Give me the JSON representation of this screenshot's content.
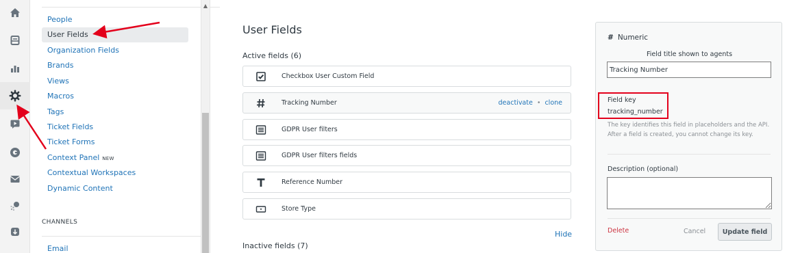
{
  "rail": {
    "items": [
      {
        "icon": "home-icon"
      },
      {
        "icon": "inbox-icon"
      },
      {
        "icon": "reporting-icon"
      },
      {
        "icon": "gear-icon",
        "active": true
      },
      {
        "icon": "play-icon"
      },
      {
        "icon": "guide-icon"
      },
      {
        "icon": "mail-icon"
      },
      {
        "icon": "explore-icon"
      },
      {
        "icon": "shield-icon"
      }
    ]
  },
  "nav": {
    "items": [
      {
        "label": "People"
      },
      {
        "label": "User Fields",
        "selected": true
      },
      {
        "label": "Organization Fields"
      },
      {
        "label": "Brands"
      },
      {
        "label": "Views"
      },
      {
        "label": "Macros"
      },
      {
        "label": "Tags"
      },
      {
        "label": "Ticket Fields"
      },
      {
        "label": "Ticket Forms"
      },
      {
        "label": "Context Panel",
        "badge": "NEW"
      },
      {
        "label": "Contextual Workspaces"
      },
      {
        "label": "Dynamic Content"
      }
    ],
    "channels_heading": "CHANNELS",
    "channels_items": [
      {
        "label": "Email"
      }
    ]
  },
  "main": {
    "title": "User Fields",
    "active_heading": "Active fields (6)",
    "inactive_heading": "Inactive fields (7)",
    "hide_label": "Hide",
    "fields": [
      {
        "name": "Checkbox User Custom Field",
        "icon": "checkbox-icon"
      },
      {
        "name": "Tracking Number",
        "icon": "hash-icon",
        "highlight": true,
        "actions": [
          "deactivate",
          "clone"
        ]
      },
      {
        "name": "GDPR User filters",
        "icon": "text-lines-icon"
      },
      {
        "name": "GDPR User filters fields",
        "icon": "text-lines-icon"
      },
      {
        "name": "Reference Number",
        "icon": "text-t-icon"
      },
      {
        "name": "Store Type",
        "icon": "dropdown-icon"
      }
    ]
  },
  "panel": {
    "type_label": "Numeric",
    "type_symbol": "#",
    "title_label": "Field title shown to agents",
    "title_value": "Tracking Number",
    "key_label": "Field key",
    "key_value": "tracking_number",
    "key_help": "The key identifies this field in placeholders and the API. After a field is created, you cannot change its key.",
    "description_label": "Description (optional)",
    "delete_label": "Delete",
    "cancel_label": "Cancel",
    "update_label": "Update field"
  },
  "colors": {
    "link": "#1f73b7",
    "annotation_red": "#e3001b",
    "delete_red": "#cc3340",
    "text": "#2f3941",
    "muted": "#8a8f94"
  }
}
